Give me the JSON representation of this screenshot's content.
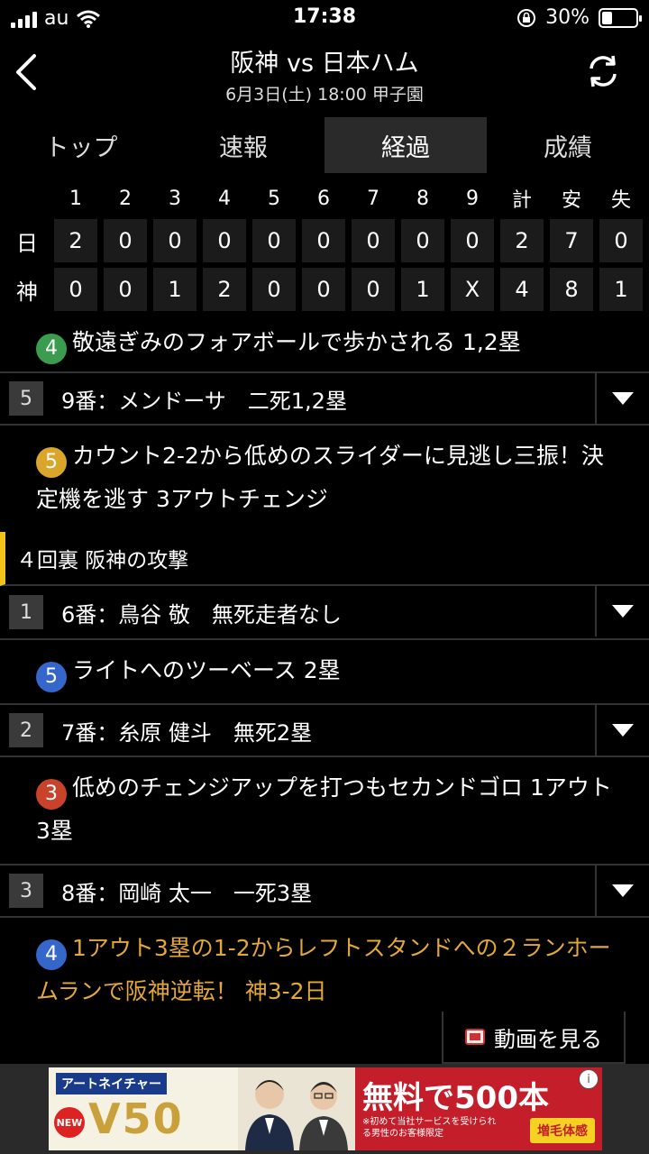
{
  "status": {
    "carrier": "au",
    "time": "17:38",
    "battery": "30%",
    "battery_level": 0.3
  },
  "header": {
    "title": "阪神 vs 日本ハム",
    "subtitle": "6月3日(土) 18:00 甲子園"
  },
  "tabs": [
    {
      "label": "トップ"
    },
    {
      "label": "速報"
    },
    {
      "label": "経過",
      "active": true
    },
    {
      "label": "成績"
    }
  ],
  "scoreboard": {
    "columns": [
      "1",
      "2",
      "3",
      "4",
      "5",
      "6",
      "7",
      "8",
      "9",
      "計",
      "安",
      "失"
    ],
    "rows": [
      {
        "team": "日",
        "cells": [
          "2",
          "0",
          "0",
          "0",
          "0",
          "0",
          "0",
          "0",
          "0",
          "2",
          "7",
          "0"
        ]
      },
      {
        "team": "神",
        "cells": [
          "0",
          "0",
          "1",
          "2",
          "0",
          "0",
          "0",
          "1",
          "X",
          "4",
          "8",
          "1"
        ]
      }
    ]
  },
  "feed": {
    "play_top": {
      "badge": "4",
      "badge_color": "#3b9c4f",
      "text": "敬遠ぎみのフォアボールで歩かされる 1,2塁"
    },
    "at_bat_5": {
      "num": "5",
      "text": "9番：メンドーサ　二死1,2塁"
    },
    "play_5": {
      "badge": "5",
      "badge_color": "#d9a52b",
      "text": "カウント2-2から低めのスライダーに見逃し三振！決定機を逃す 3アウトチェンジ"
    },
    "inning": {
      "text": "４回裏 阪神の攻撃"
    },
    "at_bat_1": {
      "num": "1",
      "text": "6番：鳥谷 敬　無死走者なし"
    },
    "play_1": {
      "badge": "5",
      "badge_color": "#3566c9",
      "text": "ライトへのツーベース 2塁"
    },
    "at_bat_2": {
      "num": "2",
      "text": "7番：糸原 健斗　無死2塁"
    },
    "play_2": {
      "badge": "3",
      "badge_color": "#c8422c",
      "text": "低めのチェンジアップを打つもセカンドゴロ 1アウト3塁"
    },
    "at_bat_3": {
      "num": "3",
      "text": "8番：岡崎 太一　一死3塁"
    },
    "play_3": {
      "badge": "4",
      "badge_color": "#3566c9",
      "text": "1アウト3塁の1-2からレフトスタンドへの２ランホームランで阪神逆転！ 神3-2日"
    }
  },
  "video_button": {
    "label": "動画を見る"
  },
  "ad": {
    "brand": "アートネイチャー",
    "new": "NEW",
    "product": "V50",
    "offer": "無料で500本",
    "note": "※初めて当社サービスを受けられる男性のお客様限定",
    "cta": "増毛体感",
    "info": "i"
  }
}
